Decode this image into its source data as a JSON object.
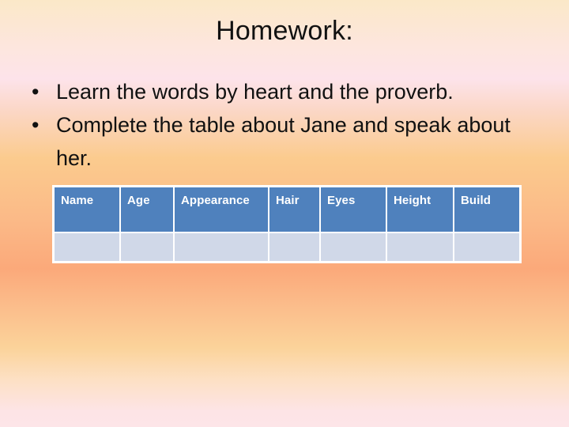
{
  "slide": {
    "title": "Homework:",
    "bullets": [
      {
        "marker": "•",
        "text": "Learn the words by heart and the proverb."
      },
      {
        "marker": "•",
        "text": "Complete the table about Jane and speak about her."
      }
    ]
  },
  "table": {
    "headers": [
      "Name",
      "Age",
      "Appearance",
      "Hair",
      "Eyes",
      "Height",
      "Build"
    ],
    "rows": [
      [
        "",
        "",
        "",
        "",
        "",
        "",
        ""
      ]
    ]
  },
  "colors": {
    "header_fill": "#4f81bd",
    "body_fill": "#d0d8e8",
    "border": "#ffffff",
    "text": "#111111"
  }
}
